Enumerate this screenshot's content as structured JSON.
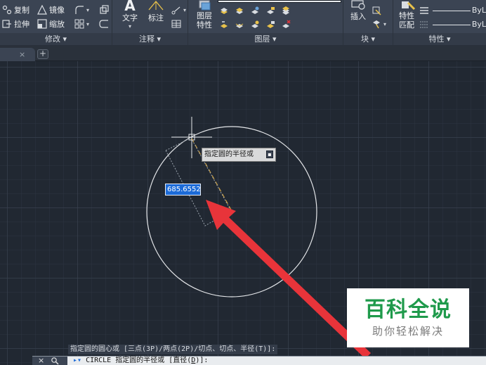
{
  "ribbon": {
    "modify": {
      "title": "修改 ▾",
      "copy": "复制",
      "mirror": "镜像",
      "stretch": "拉伸",
      "scale": "缩放"
    },
    "annotation": {
      "title": "注释 ▾",
      "text_label": "文字",
      "dimension_label": "标注"
    },
    "layers": {
      "title": "图层 ▾",
      "layer_props_line1": "图层",
      "layer_props_line2": "特性"
    },
    "block": {
      "title": "块 ▾",
      "insert": "插入"
    },
    "properties": {
      "title": "特性 ▾",
      "match_line1": "特性",
      "match_line2": "匹配",
      "bylayer1": "ByL",
      "bylayer2": "ByL"
    }
  },
  "tabs": {
    "close_glyph": "×",
    "new_glyph": "+"
  },
  "canvas": {
    "tooltip": "指定圆的半径或",
    "tooltip_btn": "▪",
    "radius_value": "685.6552"
  },
  "watermark": {
    "title": "百科全说",
    "subtitle": "助你轻松解决"
  },
  "command": {
    "history": "指定圆的圆心或 [三点(3P)/两点(2P)/切点、切点、半径(T)]:",
    "close_glyph": "×",
    "prefix": "CIRCLE 指定圆的半径或 [直径(",
    "underlined": "D",
    "suffix": ")]:"
  },
  "colors": {
    "ribbon_bg": "#3b4453",
    "canvas_bg": "#212832",
    "accent_blue": "#1c6bd8",
    "arrow_red": "#e8343a",
    "watermark_green": "#1f9a4b"
  }
}
